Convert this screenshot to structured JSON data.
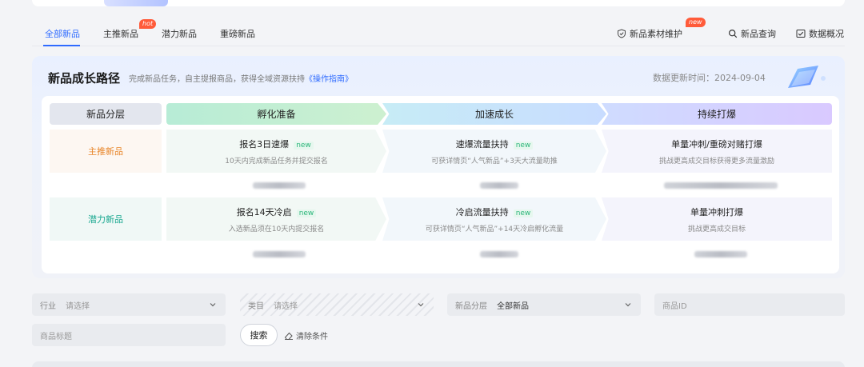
{
  "tabs": [
    {
      "label": "全部新品",
      "active": true
    },
    {
      "label": "主推新品",
      "badge": "hot"
    },
    {
      "label": "潜力新品"
    },
    {
      "label": "重磅新品"
    }
  ],
  "tools": {
    "material": {
      "label": "新品素材维护",
      "badge": "new",
      "icon": "shield-check-icon"
    },
    "query": {
      "label": "新品查询",
      "icon": "search-icon"
    },
    "overview": {
      "label": "数据概况",
      "icon": "chart-box-icon"
    }
  },
  "panel": {
    "title": "新品成长路径",
    "subtitle": "完成新品任务，自主提报商品，获得全域资源扶持",
    "guide_link": "《操作指南》",
    "update_time": "数据更新时间：2024-09-04"
  },
  "headers": {
    "layer": "新品分层",
    "stage1": "孵化准备",
    "stage2": "加速成长",
    "stage3": "持续打爆"
  },
  "rows": [
    {
      "label": "主推新品",
      "cells": [
        {
          "title": "报名3日速爆",
          "tag": "new",
          "sub": "10天内完成新品任务并提交报名"
        },
        {
          "title": "速爆流量扶持",
          "tag": "new",
          "sub": "可获详情页“人气新品”+3天大流量助推"
        },
        {
          "title": "单量冲刺/重磅对赌打爆",
          "tag": "",
          "sub": "挑战更高成交目标获得更多流量激励"
        }
      ]
    },
    {
      "label": "潜力新品",
      "cells": [
        {
          "title": "报名14天冷启",
          "tag": "new",
          "sub": "入选新品须在10天内提交报名"
        },
        {
          "title": "冷启流量扶持",
          "tag": "new",
          "sub": "可获详情页“人气新品”+14天冷启孵化流量"
        },
        {
          "title": "单量冲刺打爆",
          "tag": "",
          "sub": "挑战更高成交目标"
        }
      ]
    }
  ],
  "filters": {
    "industry": {
      "label": "行业",
      "placeholder": "请选择"
    },
    "category": {
      "label": "类目",
      "placeholder": "请选择"
    },
    "layer": {
      "label": "新品分层",
      "value": "全部新品"
    },
    "product_id": {
      "placeholder": "商品ID"
    },
    "product_title": {
      "placeholder": "商品标题"
    }
  },
  "actions": {
    "search": "搜索",
    "clear": "清除条件"
  },
  "colors": {
    "accent": "#2f6bff",
    "hot": "#ff5b3a",
    "main_new": "#e8862a",
    "potential_new": "#1aa890",
    "new_tag": "#2db67b"
  }
}
